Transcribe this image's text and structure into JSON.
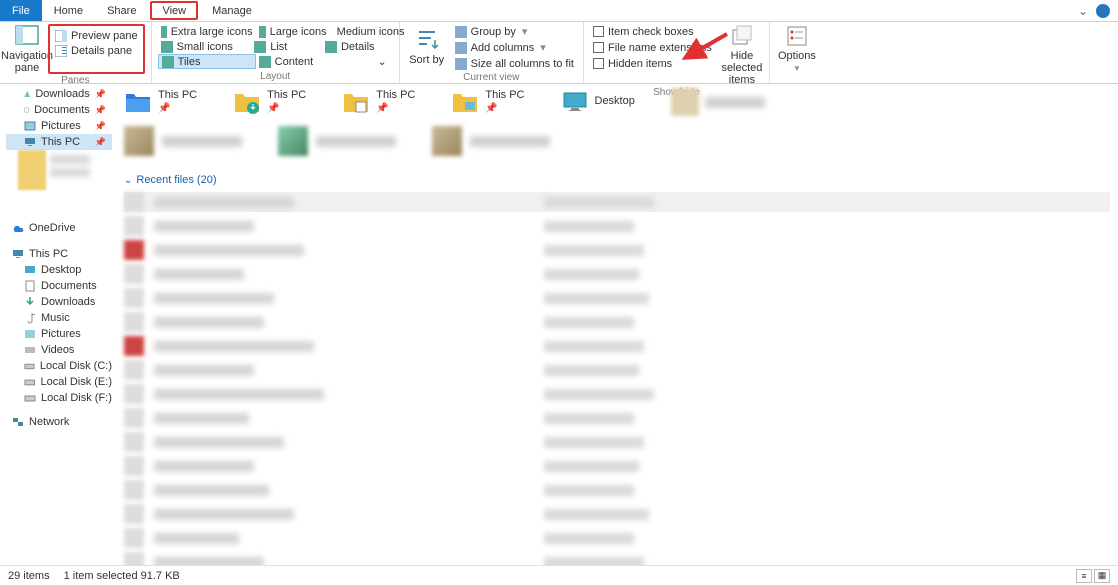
{
  "tabs": {
    "file": "File",
    "home": "Home",
    "share": "Share",
    "view": "View",
    "manage": "Manage"
  },
  "ribbon": {
    "panes": {
      "nav_label": "Navigation pane",
      "preview": "Preview pane",
      "details": "Details pane",
      "group": "Panes"
    },
    "layout": {
      "xl": "Extra large icons",
      "large": "Large icons",
      "medium": "Medium icons",
      "small": "Small icons",
      "list": "List",
      "det": "Details",
      "tiles": "Tiles",
      "content": "Content",
      "group": "Layout"
    },
    "currentview": {
      "sortby": "Sort by",
      "groupby": "Group by",
      "addcols": "Add columns",
      "sizecols": "Size all columns to fit",
      "group": "Current view"
    },
    "showhide": {
      "itemchk": "Item check boxes",
      "fne": "File name extensions",
      "hidden": "Hidden items",
      "hidesel": "Hide selected items",
      "group": "Show/hide"
    },
    "options": "Options"
  },
  "quick_access": [
    {
      "title": "This PC",
      "sub": "Pinned"
    },
    {
      "title": "This PC",
      "sub": "Pinned"
    },
    {
      "title": "This PC",
      "sub": "Pinned"
    },
    {
      "title": "This PC",
      "sub": "Pinned"
    },
    {
      "title": "Desktop",
      "sub": ""
    }
  ],
  "recent_header": "Recent files (20)",
  "recent_count": 20,
  "sidebar": {
    "quick": [
      "Downloads",
      "Documents",
      "Pictures",
      "This PC"
    ],
    "onedrive": "OneDrive",
    "thispc": "This PC",
    "thispc_children": [
      "Desktop",
      "Documents",
      "Downloads",
      "Music",
      "Pictures",
      "Videos",
      "Local Disk (C:)",
      "Local Disk (E:)",
      "Local Disk (F:)"
    ],
    "network": "Network"
  },
  "status": {
    "items": "29 items",
    "selected": "1 item selected  91.7 KB"
  },
  "icons": {
    "nav": "navigation-pane-icon",
    "prev": "preview-pane-icon",
    "det": "details-pane-icon",
    "sort": "sort-icon",
    "hide": "hide-icon",
    "opt": "options-icon",
    "folder": "folder-icon",
    "desktop": "desktop-icon",
    "monitor": "monitor-icon",
    "downloads": "downloads-icon",
    "docs": "documents-icon",
    "pics": "pictures-icon",
    "music": "music-icon",
    "videos": "videos-icon",
    "disk": "disk-icon",
    "network": "network-icon",
    "onedrive": "onedrive-icon"
  }
}
